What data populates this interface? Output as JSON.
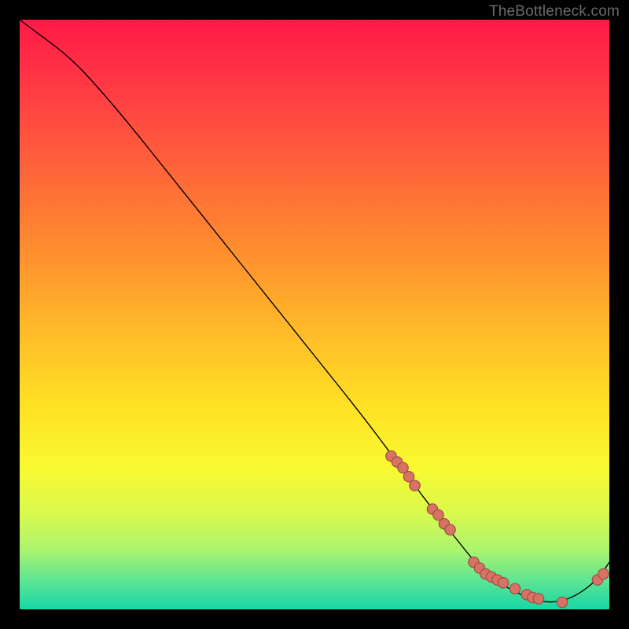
{
  "watermark": "TheBottleneck.com",
  "chart_data": {
    "type": "line",
    "title": "",
    "xlabel": "",
    "ylabel": "",
    "xlim": [
      0,
      100
    ],
    "ylim": [
      0,
      100
    ],
    "grid": false,
    "legend": false,
    "colors": {
      "curve": "#000000",
      "points_fill": "#d77264",
      "points_stroke": "#9a4b42",
      "bg_top": "#ff1a47",
      "bg_bottom": "#17d7a6"
    },
    "series": [
      {
        "name": "bottleneck-curve",
        "x": [
          0,
          4,
          8,
          12,
          18,
          26,
          34,
          42,
          50,
          58,
          64,
          70,
          74,
          78,
          82,
          86,
          90,
          94,
          98,
          100
        ],
        "y": [
          100,
          97,
          94,
          90,
          83,
          73,
          63,
          53,
          43,
          33,
          25,
          17,
          12,
          7,
          4,
          2,
          1,
          2,
          5,
          8
        ]
      }
    ],
    "scatter": [
      {
        "name": "highlighted-points",
        "x": [
          63,
          64,
          65,
          66,
          67,
          70,
          71,
          72,
          73,
          77,
          78,
          79,
          80,
          81,
          82,
          84,
          86,
          87,
          88,
          92,
          98,
          99
        ],
        "y": [
          26,
          25,
          24,
          22.5,
          21,
          17,
          16,
          14.5,
          13.5,
          8,
          7,
          6,
          5.5,
          5,
          4.5,
          3.5,
          2.5,
          2,
          1.8,
          1.2,
          5,
          6
        ]
      }
    ]
  }
}
